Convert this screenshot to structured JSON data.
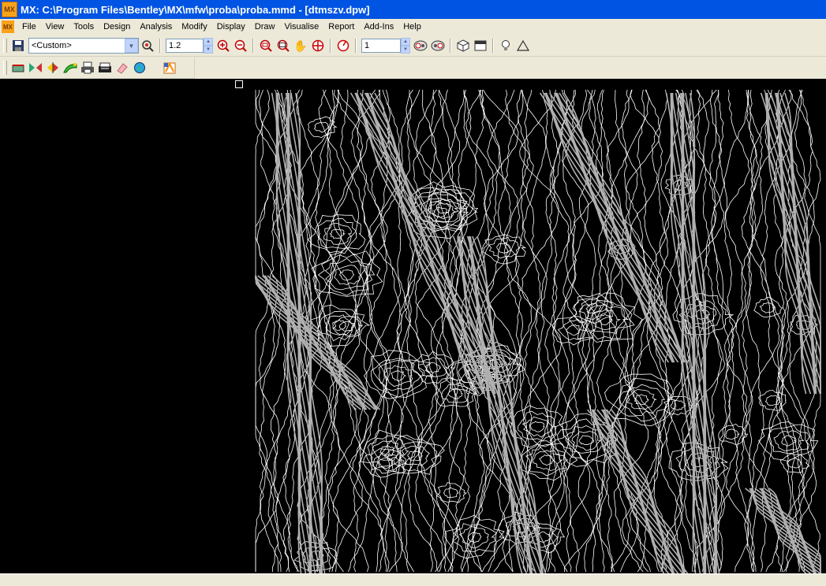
{
  "window": {
    "title": "MX: C:\\Program Files\\Bentley\\MX\\mfw\\proba\\proba.mmd - [dtmszv.dpw]",
    "app_badge": "MX"
  },
  "menu": {
    "badge": "MX",
    "items": [
      "File",
      "View",
      "Tools",
      "Design",
      "Analysis",
      "Modify",
      "Display",
      "Draw",
      "Visualise",
      "Report",
      "Add-Ins",
      "Help"
    ]
  },
  "toolbar": {
    "view_combo": "<Custom>",
    "scale_value": "1.2",
    "layer_value": "1"
  },
  "colors": {
    "titlebar": "#0054e3",
    "canvas": "#000000",
    "contour": "#ffffff",
    "steep": "#b0b0b0"
  }
}
